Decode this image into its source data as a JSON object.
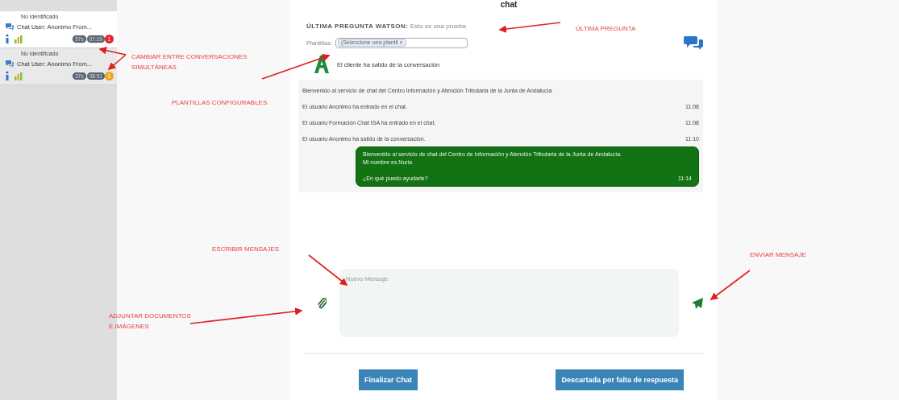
{
  "page_title": "chat",
  "conversations": [
    {
      "status": "No identificado",
      "title": "Chat User: Anonimo From...",
      "wait": "57s",
      "duration": "07:19",
      "count": "1",
      "color": "#e8252a",
      "selected": true
    },
    {
      "status": "No identificado",
      "title": "Chat User: Anonimo From...",
      "wait": "37s",
      "duration": "08:51",
      "count": "1",
      "color": "#f0a422",
      "selected": false
    }
  ],
  "last_question": "**ÚLTIMA PREGUNTA WATSON:** Esto es una prueba",
  "templates": {
    "label": "Plantillas:",
    "placeholder": "(Seleccione una plantil ×"
  },
  "client_notice": "El cliente ha salido de la conversación",
  "messages": [
    {
      "kind": "system",
      "text": "Bienvenido al servicio de chat del Centro Información y Atención Tributaria de la Junta de Andalucía"
    },
    {
      "kind": "system",
      "text": "El usuario Anonimo ha entrado en el chat.",
      "time": "11:08"
    },
    {
      "kind": "system",
      "text": "El usuario Formación Chat ISA ha entrado en el chat.",
      "time": "11:08"
    },
    {
      "kind": "system",
      "text": "El usuario Anonimo ha salido de la conversación.",
      "time": "11:10"
    },
    {
      "kind": "agent",
      "lines": [
        "Bienvenido al servicio de chat del Centro de Información y Atención Tributaria de la Junta de Andalucía. Mi nombre es Nuria",
        "¿En qué puedo ayudarle?"
      ],
      "time": "11:14"
    }
  ],
  "composer": {
    "placeholder": "Nuevo Mensaje"
  },
  "buttons": [
    "Finalizar Chat",
    "Descartada por falta de respuesta"
  ],
  "annotations": [
    {
      "text": "ÚLTIMA PREGUNTA"
    },
    {
      "text": "CAMBIAR ENTRE CONVERSACIONES\nSIMULTÁNEAS"
    },
    {
      "text": "PLANTILLAS CONFIGURABLES"
    },
    {
      "text": "ESCRIBIR MENSAJES"
    },
    {
      "text": "ADJUNTAR DOCUMENTOS\nE IMÁGENES"
    },
    {
      "text": "ENVIAR MENSAJE"
    }
  ]
}
